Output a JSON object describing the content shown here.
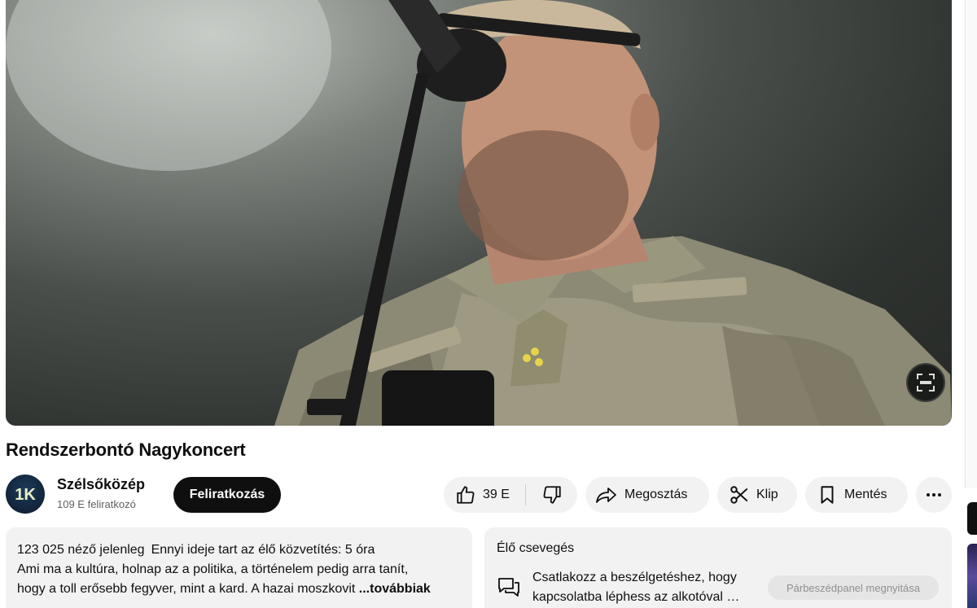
{
  "video": {
    "title": "Rendszerbontó Nagykoncert",
    "watermark_icon": "channel-watermark-icon"
  },
  "channel": {
    "name": "Szélsőközép",
    "subscribers": "109 E feliratkozó",
    "subscribe_label": "Feliratkozás",
    "avatar_text": "1K"
  },
  "actions": {
    "like_count": "39 E",
    "share_label": "Megosztás",
    "clip_label": "Klip",
    "save_label": "Mentés",
    "more_icon": "more-horizontal-icon"
  },
  "description": {
    "viewers": "123 025 néző jelenleg",
    "live_duration": "Ennyi ideje tart az élő közvetítés: 5 óra",
    "text_line1": "Ami ma a kultúra, holnap az a politika, a történelem pedig arra tanít,",
    "text_line2": "hogy a toll erősebb fegyver, mint a kard. A hazai moszkovit",
    "more_label": "...továbbiak"
  },
  "live_chat": {
    "title": "Élő csevegés",
    "prompt": "Csatlakozz a beszélgetéshez, hogy kapcsolatba léphess az alkotóval …",
    "open_button": "Párbeszédpanel megnyitása"
  },
  "colors": {
    "background": "#ffffff",
    "pill": "#f2f2f2",
    "subscribe_bg": "#0f0f0f",
    "text": "#0f0f0f",
    "muted": "#606060"
  }
}
